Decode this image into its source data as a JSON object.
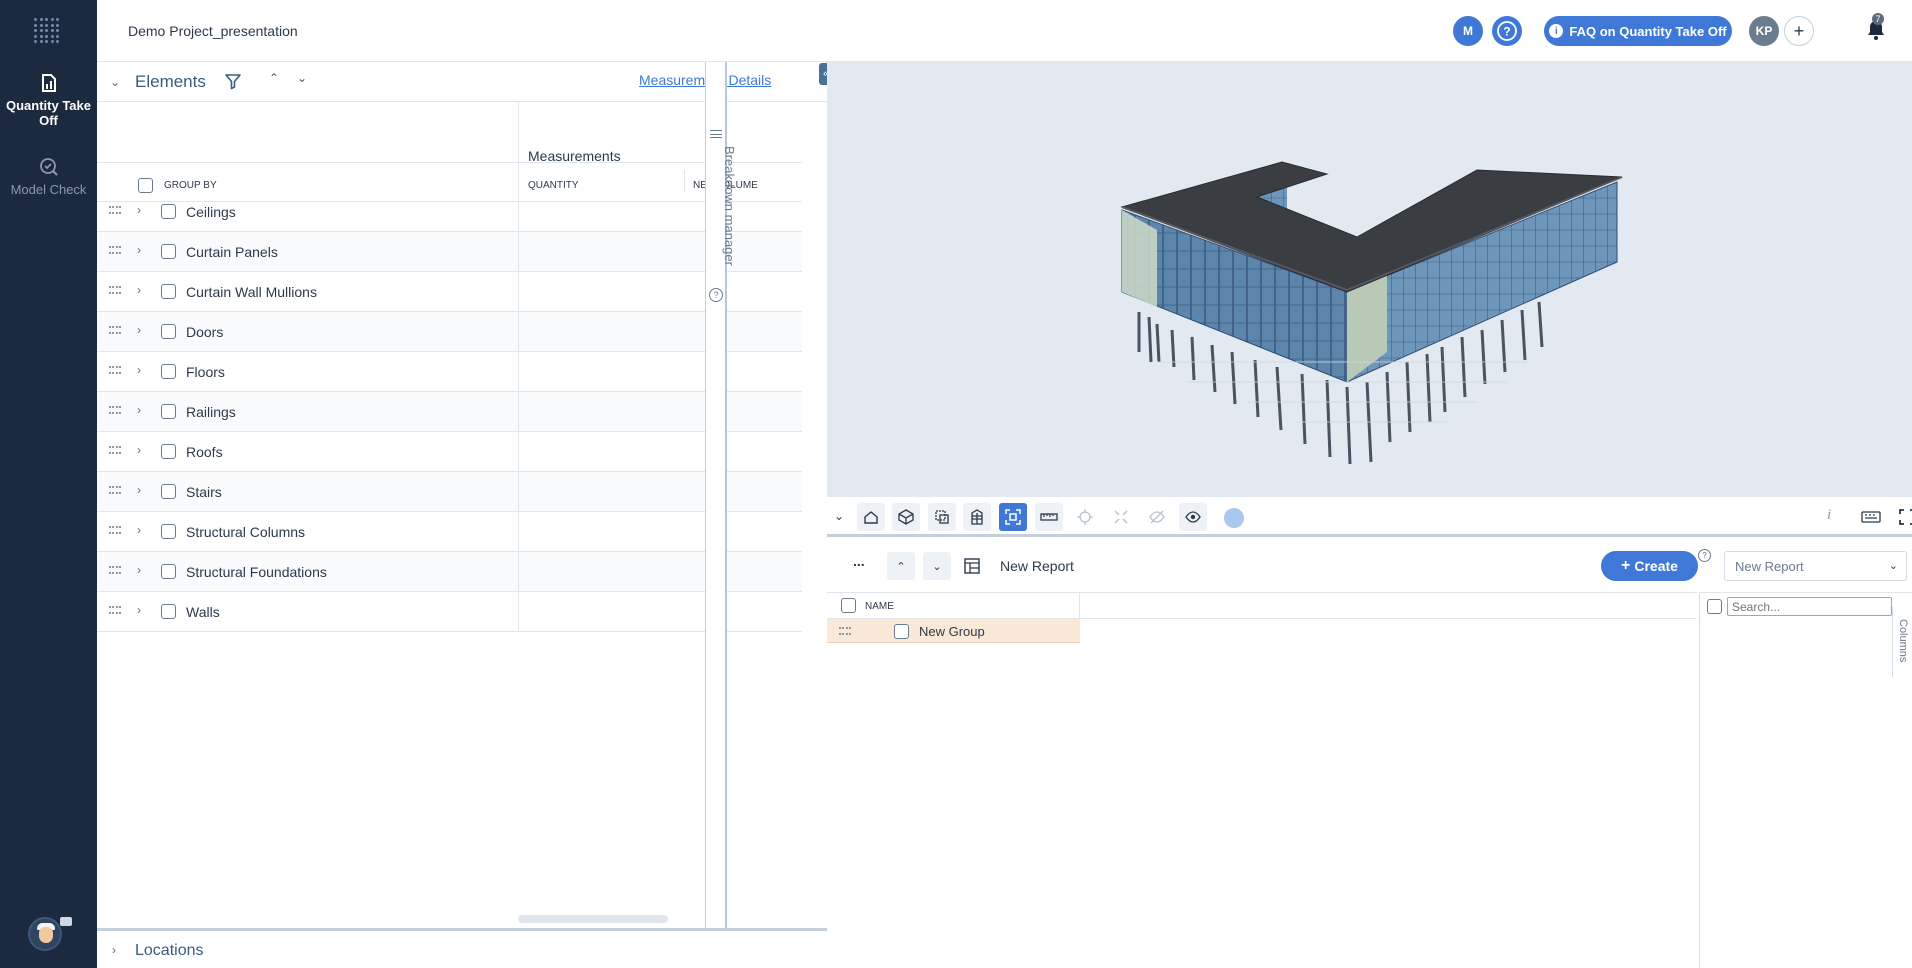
{
  "sidebar": {
    "items": [
      {
        "label": "Quantity Take Off",
        "icon": "quantity-takeoff-icon",
        "active": true
      },
      {
        "label": "Model Check",
        "icon": "model-check-icon",
        "active": false
      }
    ]
  },
  "header": {
    "project_name": "Demo Project_presentation",
    "user_initial": "M",
    "help_icon": "help-icon",
    "faq_label": "FAQ on Quantity Take Off",
    "avatar_initials": "KP",
    "notification_count": "7",
    "colors": {
      "accent": "#3f78d6",
      "sidebar": "#1b2a3e",
      "avatar_gray": "#6b7c8f"
    }
  },
  "elements_panel": {
    "title": "Elements",
    "measurement_details_link": "Measurement Details",
    "measurements_header": "Measurements",
    "columns": {
      "group_by": "GROUP BY",
      "quantity": "QUANTITY",
      "net_volume": "NET VOLUME"
    },
    "rows": [
      "Ceilings",
      "Curtain Panels",
      "Curtain Wall Mullions",
      "Doors",
      "Floors",
      "Railings",
      "Roofs",
      "Stairs",
      "Structural Columns",
      "Structural Foundations",
      "Walls"
    ]
  },
  "breakdown_manager": {
    "label": "Breakdown manager",
    "help": "?"
  },
  "locations": {
    "title": "Locations"
  },
  "viewer": {
    "tools": [
      "home-icon",
      "cube-icon",
      "section-box-icon",
      "building-icon",
      "fit-view-icon",
      "measure-icon",
      "target-icon",
      "explode-icon",
      "hide-icon",
      "show-icon"
    ],
    "active_tool": "fit-view-icon",
    "info_label": "i"
  },
  "report": {
    "more_label": "...",
    "name": "New Report",
    "create_label": "Create",
    "create_help": "?",
    "select_value": "New Report",
    "name_header": "NAME",
    "group_name": "New Group",
    "search_placeholder": "Search...",
    "columns_tab": "Columns"
  }
}
